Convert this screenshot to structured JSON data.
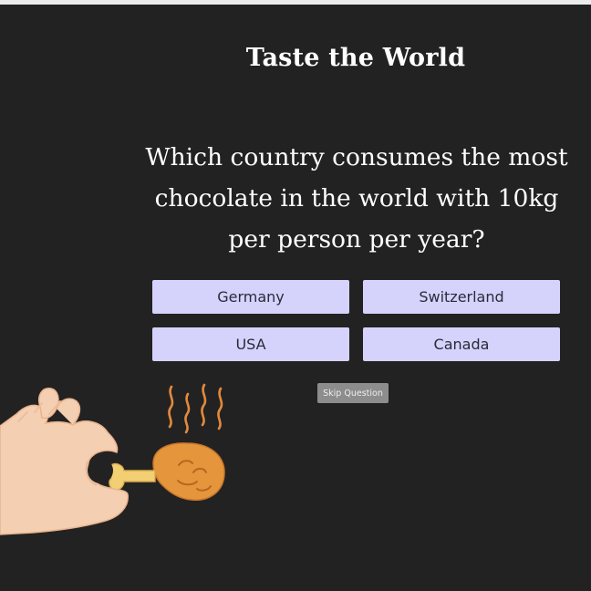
{
  "app": {
    "title": "Taste the World"
  },
  "quiz": {
    "question": "Which country consumes the most chocolate in the world with 10kg per person per year?",
    "answers": [
      "Germany",
      "Switzerland",
      "USA",
      "Canada"
    ],
    "skip_label": "Skip Question"
  },
  "illustration": {
    "icon": "hand-holding-drumstick-icon"
  },
  "colors": {
    "background": "#232222",
    "answer_button": "#d5d3fb",
    "skip_button": "#8d8d8d",
    "title_text": "#ffffff"
  }
}
